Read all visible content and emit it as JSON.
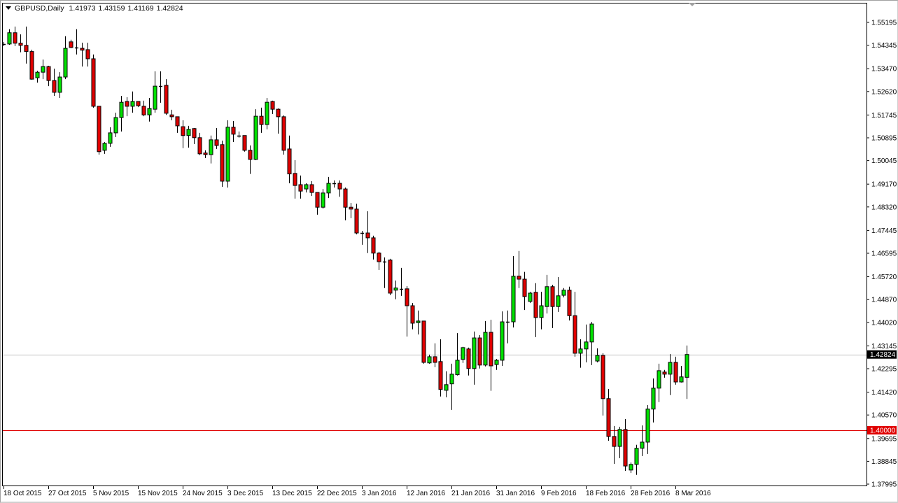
{
  "header": {
    "symbol": "GBPUSD,Daily",
    "open": "1.41973",
    "high": "1.43159",
    "low": "1.41169",
    "close": "1.42824"
  },
  "colors": {
    "bull": "#00e000",
    "bear": "#e00000",
    "outline": "#000000",
    "current_line": "#c0c0c0",
    "level_line": "#e00000"
  },
  "chart_data": {
    "type": "candlestick",
    "title": "GBPUSD,Daily",
    "ylim": [
      1.37995,
      1.55195
    ],
    "grid": false,
    "y_ticks": [
      "1.55195",
      "1.54345",
      "1.53470",
      "1.52620",
      "1.51745",
      "1.50895",
      "1.50045",
      "1.49170",
      "1.48320",
      "1.47445",
      "1.46595",
      "1.45720",
      "1.44870",
      "1.44020",
      "1.43145",
      "1.42295",
      "1.41420",
      "1.40570",
      "1.39695",
      "1.38845",
      "1.37995"
    ],
    "x_labels": [
      {
        "index": 0,
        "label": "18 Oct 2015"
      },
      {
        "index": 8,
        "label": "27 Oct 2015"
      },
      {
        "index": 16,
        "label": "5 Nov 2015"
      },
      {
        "index": 24,
        "label": "15 Nov 2015"
      },
      {
        "index": 32,
        "label": "24 Nov 2015"
      },
      {
        "index": 40,
        "label": "3 Dec 2015"
      },
      {
        "index": 48,
        "label": "13 Dec 2015"
      },
      {
        "index": 56,
        "label": "22 Dec 2015"
      },
      {
        "index": 64,
        "label": "3 Jan 2016"
      },
      {
        "index": 72,
        "label": "12 Jan 2016"
      },
      {
        "index": 80,
        "label": "21 Jan 2016"
      },
      {
        "index": 88,
        "label": "31 Jan 2016"
      },
      {
        "index": 96,
        "label": "9 Feb 2016"
      },
      {
        "index": 104,
        "label": "18 Feb 2016"
      },
      {
        "index": 112,
        "label": "28 Feb 2016"
      },
      {
        "index": 120,
        "label": "8 Mar 2016"
      }
    ],
    "current_price": {
      "value": 1.42824,
      "label": "1.42824"
    },
    "level_line": {
      "value": 1.4,
      "label": "1.40000"
    },
    "ohlc": [
      [
        1.5439,
        1.5447,
        1.5431,
        1.544
      ],
      [
        1.5439,
        1.5494,
        1.5436,
        1.5481
      ],
      [
        1.5481,
        1.5504,
        1.5431,
        1.5442
      ],
      [
        1.5442,
        1.5475,
        1.5408,
        1.5434
      ],
      [
        1.5434,
        1.5504,
        1.5366,
        1.5411
      ],
      [
        1.5411,
        1.5418,
        1.5306,
        1.5308
      ],
      [
        1.5313,
        1.5339,
        1.5295,
        1.5334
      ],
      [
        1.5334,
        1.5381,
        1.5308,
        1.5355
      ],
      [
        1.5355,
        1.5358,
        1.5282,
        1.5303
      ],
      [
        1.5303,
        1.5347,
        1.5246,
        1.5259
      ],
      [
        1.5259,
        1.5334,
        1.5238,
        1.5316
      ],
      [
        1.5316,
        1.5468,
        1.5308,
        1.5423
      ],
      [
        1.5447,
        1.5455,
        1.5423,
        1.5426
      ],
      [
        1.5426,
        1.5494,
        1.54,
        1.5426
      ],
      [
        1.5423,
        1.5444,
        1.5355,
        1.5416
      ],
      [
        1.5418,
        1.5444,
        1.5355,
        1.5384
      ],
      [
        1.5384,
        1.54,
        1.5202,
        1.5207
      ],
      [
        1.5207,
        1.5207,
        1.5027,
        1.5038
      ],
      [
        1.5043,
        1.5074,
        1.503,
        1.5069
      ],
      [
        1.5069,
        1.5129,
        1.5056,
        1.5108
      ],
      [
        1.5108,
        1.5183,
        1.5092,
        1.5165
      ],
      [
        1.5165,
        1.5246,
        1.5113,
        1.5222
      ],
      [
        1.5225,
        1.5241,
        1.517,
        1.5207
      ],
      [
        1.5207,
        1.5262,
        1.5183,
        1.5225
      ],
      [
        1.5225,
        1.5225,
        1.5204,
        1.5209
      ],
      [
        1.5207,
        1.5228,
        1.517,
        1.5175
      ],
      [
        1.5175,
        1.5238,
        1.515,
        1.5199
      ],
      [
        1.5196,
        1.5337,
        1.5183,
        1.5282
      ],
      [
        1.5282,
        1.5337,
        1.522,
        1.5282
      ],
      [
        1.5285,
        1.5308,
        1.5175,
        1.5181
      ],
      [
        1.5175,
        1.5194,
        1.5155,
        1.5168
      ],
      [
        1.5168,
        1.5168,
        1.5108,
        1.5134
      ],
      [
        1.5131,
        1.5155,
        1.5051,
        1.5098
      ],
      [
        1.5098,
        1.5134,
        1.5053,
        1.5121
      ],
      [
        1.5124,
        1.5126,
        1.5066,
        1.509
      ],
      [
        1.509,
        1.5108,
        1.5025,
        1.503
      ],
      [
        1.5033,
        1.5043,
        1.5014,
        1.5027
      ],
      [
        1.5027,
        1.5098,
        1.4994,
        1.5082
      ],
      [
        1.5082,
        1.5126,
        1.5048,
        1.5061
      ],
      [
        1.5064,
        1.5079,
        1.4907,
        1.4928
      ],
      [
        1.4928,
        1.5155,
        1.4904,
        1.5129
      ],
      [
        1.5129,
        1.5152,
        1.5074,
        1.5103
      ],
      [
        1.5098,
        1.5113,
        1.509,
        1.5098
      ],
      [
        1.5098,
        1.5098,
        1.5038,
        1.5043
      ],
      [
        1.5043,
        1.5061,
        1.4955,
        1.5009
      ],
      [
        1.5009,
        1.5196,
        1.5006,
        1.517
      ],
      [
        1.517,
        1.5202,
        1.5108,
        1.5139
      ],
      [
        1.5139,
        1.5238,
        1.5121,
        1.5222
      ],
      [
        1.5225,
        1.5228,
        1.5178,
        1.5196
      ],
      [
        1.5196,
        1.5199,
        1.5105,
        1.5168
      ],
      [
        1.5168,
        1.5173,
        1.5027,
        1.5043
      ],
      [
        1.5048,
        1.5098,
        1.492,
        1.4955
      ],
      [
        1.4957,
        1.5006,
        1.4863,
        1.4912
      ],
      [
        1.4915,
        1.4949,
        1.4863,
        1.4891
      ],
      [
        1.4899,
        1.492,
        1.4886,
        1.4915
      ],
      [
        1.4915,
        1.4928,
        1.4873,
        1.4886
      ],
      [
        1.4886,
        1.4886,
        1.4803,
        1.4831
      ],
      [
        1.4831,
        1.4899,
        1.4826,
        1.4884
      ],
      [
        1.4884,
        1.4944,
        1.4865,
        1.492
      ],
      [
        1.492,
        1.4931,
        1.4904,
        1.492
      ],
      [
        1.492,
        1.4931,
        1.487,
        1.4899
      ],
      [
        1.4899,
        1.4904,
        1.4782,
        1.4831
      ],
      [
        1.4831,
        1.4847,
        1.479,
        1.4824
      ],
      [
        1.4824,
        1.4844,
        1.473,
        1.4735
      ],
      [
        1.4735,
        1.4743,
        1.4691,
        1.4735
      ],
      [
        1.4735,
        1.4816,
        1.466,
        1.4717
      ],
      [
        1.4717,
        1.4725,
        1.4636,
        1.466
      ],
      [
        1.466,
        1.4665,
        1.4597,
        1.4628
      ],
      [
        1.4628,
        1.4644,
        1.453,
        1.4628
      ],
      [
        1.4634,
        1.4639,
        1.4503,
        1.4511
      ],
      [
        1.4522,
        1.4558,
        1.4488,
        1.453
      ],
      [
        1.4527,
        1.4605,
        1.4501,
        1.4527
      ],
      [
        1.4527,
        1.4537,
        1.4349,
        1.4464
      ],
      [
        1.4464,
        1.4474,
        1.4376,
        1.4399
      ],
      [
        1.4401,
        1.4446,
        1.4357,
        1.4407
      ],
      [
        1.4407,
        1.4407,
        1.4248,
        1.4253
      ],
      [
        1.4251,
        1.4282,
        1.4248,
        1.4274
      ],
      [
        1.4274,
        1.4324,
        1.4235,
        1.4253
      ],
      [
        1.4256,
        1.4339,
        1.4126,
        1.4152
      ],
      [
        1.4149,
        1.422,
        1.4123,
        1.417
      ],
      [
        1.4173,
        1.4248,
        1.4076,
        1.4209
      ],
      [
        1.4207,
        1.4362,
        1.4204,
        1.4261
      ],
      [
        1.4264,
        1.4311,
        1.4251,
        1.4308
      ],
      [
        1.4303,
        1.4308,
        1.4204,
        1.423
      ],
      [
        1.423,
        1.4368,
        1.417,
        1.4344
      ],
      [
        1.4344,
        1.4355,
        1.423,
        1.4243
      ],
      [
        1.4243,
        1.4407,
        1.4238,
        1.4365
      ],
      [
        1.4365,
        1.4412,
        1.4147,
        1.424
      ],
      [
        1.4245,
        1.4266,
        1.4225,
        1.4261
      ],
      [
        1.4261,
        1.4443,
        1.424,
        1.4404
      ],
      [
        1.4404,
        1.4446,
        1.4324,
        1.4404
      ],
      [
        1.4404,
        1.4649,
        1.4383,
        1.4574
      ],
      [
        1.4574,
        1.4668,
        1.453,
        1.4563
      ],
      [
        1.4563,
        1.459,
        1.4448,
        1.4498
      ],
      [
        1.448,
        1.4516,
        1.4474,
        1.4511
      ],
      [
        1.4514,
        1.4548,
        1.4347,
        1.442
      ],
      [
        1.442,
        1.4516,
        1.4376,
        1.4464
      ],
      [
        1.4461,
        1.4579,
        1.4435,
        1.4535
      ],
      [
        1.4535,
        1.4542,
        1.4381,
        1.4461
      ],
      [
        1.4461,
        1.4571,
        1.4441,
        1.4501
      ],
      [
        1.4503,
        1.453,
        1.4495,
        1.4522
      ],
      [
        1.4522,
        1.4535,
        1.4409,
        1.4427
      ],
      [
        1.4427,
        1.4516,
        1.4274,
        1.4287
      ],
      [
        1.4287,
        1.4339,
        1.4233,
        1.4303
      ],
      [
        1.4303,
        1.4394,
        1.4253,
        1.4329
      ],
      [
        1.4329,
        1.4404,
        1.4243,
        1.4396
      ],
      [
        1.4258,
        1.4305,
        1.4253,
        1.4279
      ],
      [
        1.4279,
        1.4287,
        1.4055,
        1.4118
      ],
      [
        1.4118,
        1.4154,
        1.3961,
        1.3977
      ],
      [
        1.3977,
        1.4016,
        1.3875,
        1.394
      ],
      [
        1.394,
        1.4013,
        1.3896,
        1.4003
      ],
      [
        1.4003,
        1.4042,
        1.3849,
        1.3867
      ],
      [
        1.3852,
        1.388,
        1.3841,
        1.3873
      ],
      [
        1.3873,
        1.3946,
        1.3834,
        1.3933
      ],
      [
        1.3933,
        1.4018,
        1.3904,
        1.3956
      ],
      [
        1.3956,
        1.4094,
        1.3912,
        1.4079
      ],
      [
        1.4079,
        1.4193,
        1.4029,
        1.4157
      ],
      [
        1.4157,
        1.4248,
        1.4105,
        1.4222
      ],
      [
        1.4217,
        1.4225,
        1.4196,
        1.4209
      ],
      [
        1.4209,
        1.4284,
        1.4131,
        1.4253
      ],
      [
        1.4253,
        1.4274,
        1.417,
        1.418
      ],
      [
        1.418,
        1.424,
        1.4178,
        1.4199
      ],
      [
        1.41973,
        1.43159,
        1.41169,
        1.42824
      ]
    ]
  }
}
